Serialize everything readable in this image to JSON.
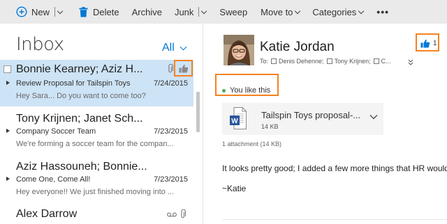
{
  "toolbar": {
    "new_label": "New",
    "delete_label": "Delete",
    "archive_label": "Archive",
    "junk_label": "Junk",
    "sweep_label": "Sweep",
    "moveto_label": "Move to",
    "categories_label": "Categories",
    "more_label": "•••"
  },
  "list": {
    "title": "Inbox",
    "filter": "All",
    "messages": [
      {
        "from": "Bonnie Kearney; Aziz H...",
        "subject": "Review Proposal for Tailspin Toys",
        "date": "7/24/2015",
        "preview": "Hey Sara... Do you want to come too?",
        "selected": true,
        "icons": [
          "paperclip-icon",
          "thumbs-up-icon"
        ]
      },
      {
        "from": "Tony Krijnen; Janet Sch...",
        "subject": "Company Soccer Team",
        "date": "7/23/2015",
        "preview": "We're forming a soccer team for the compan..."
      },
      {
        "from": "Aziz Hassouneh; Bonnie...",
        "subject": "Come One, Come All!",
        "date": "7/23/2015",
        "preview": "Hey everyone!! We just finished moving into ..."
      },
      {
        "from": "Alex Darrow",
        "icons": [
          "voicemail-icon",
          "paperclip-icon"
        ]
      }
    ]
  },
  "reading": {
    "sender": "Katie Jordan",
    "to_label": "To:",
    "recipients": [
      "Denis Dehenne;",
      "Tony Krijnen;",
      "C..."
    ],
    "like_count": "1",
    "you_like_this": "You like this",
    "attachment": {
      "name": "Tailspin Toys proposal-...",
      "size": "14 KB"
    },
    "attachment_count": "1 attachment (14 KB)",
    "body_line1": "It looks pretty good; I added a few more things that HR would",
    "body_line2": "~Katie"
  },
  "colors": {
    "accent": "#0078d7",
    "highlight_box": "#f58220",
    "selected_row": "#cde3f6",
    "toolbar_bg": "#eaeaea",
    "like_dot": "#4cae4f",
    "word_blue": "#2b579a"
  }
}
